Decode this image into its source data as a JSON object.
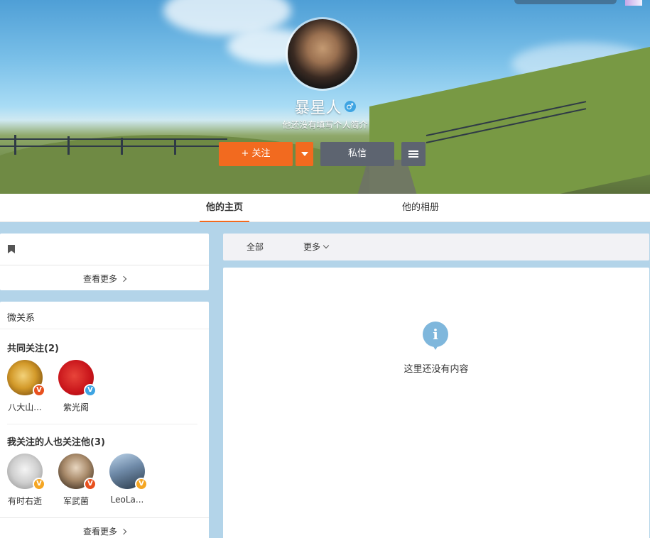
{
  "profile": {
    "name": "暴星人",
    "gender_symbol": "♂",
    "bio": "他还没有填写个人简介"
  },
  "actions": {
    "follow_label": "+ 关注",
    "message_label": "私信"
  },
  "tabs": [
    {
      "label": "他的主页",
      "active": true
    },
    {
      "label": "他的相册",
      "active": false
    }
  ],
  "left_card1": {
    "more_label": "查看更多"
  },
  "relations": {
    "title": "微关系",
    "mutual_title": "共同关注(2)",
    "mutual_users": [
      {
        "name": "八大山...",
        "badge": "V",
        "badge_color": "#e8501e"
      },
      {
        "name": "紫光阁",
        "badge": "V",
        "badge_color": "#3ea4e2"
      }
    ],
    "also_title": "我关注的人也关注他(3)",
    "also_users": [
      {
        "name": "有时右逝",
        "badge": "V",
        "badge_color": "#f5a623"
      },
      {
        "name": "军武菌",
        "badge": "V",
        "badge_color": "#e8501e"
      },
      {
        "name": "LeoLa...",
        "badge": "V",
        "badge_color": "#f5a623"
      }
    ],
    "more_label": "查看更多"
  },
  "feed": {
    "filter_all": "全部",
    "filter_more": "更多",
    "empty_text": "这里还没有内容",
    "empty_icon": "info-icon"
  },
  "colors": {
    "accent": "#f26a1f",
    "dark_button": "#5d6470",
    "page_bg": "#b3d4e9"
  }
}
